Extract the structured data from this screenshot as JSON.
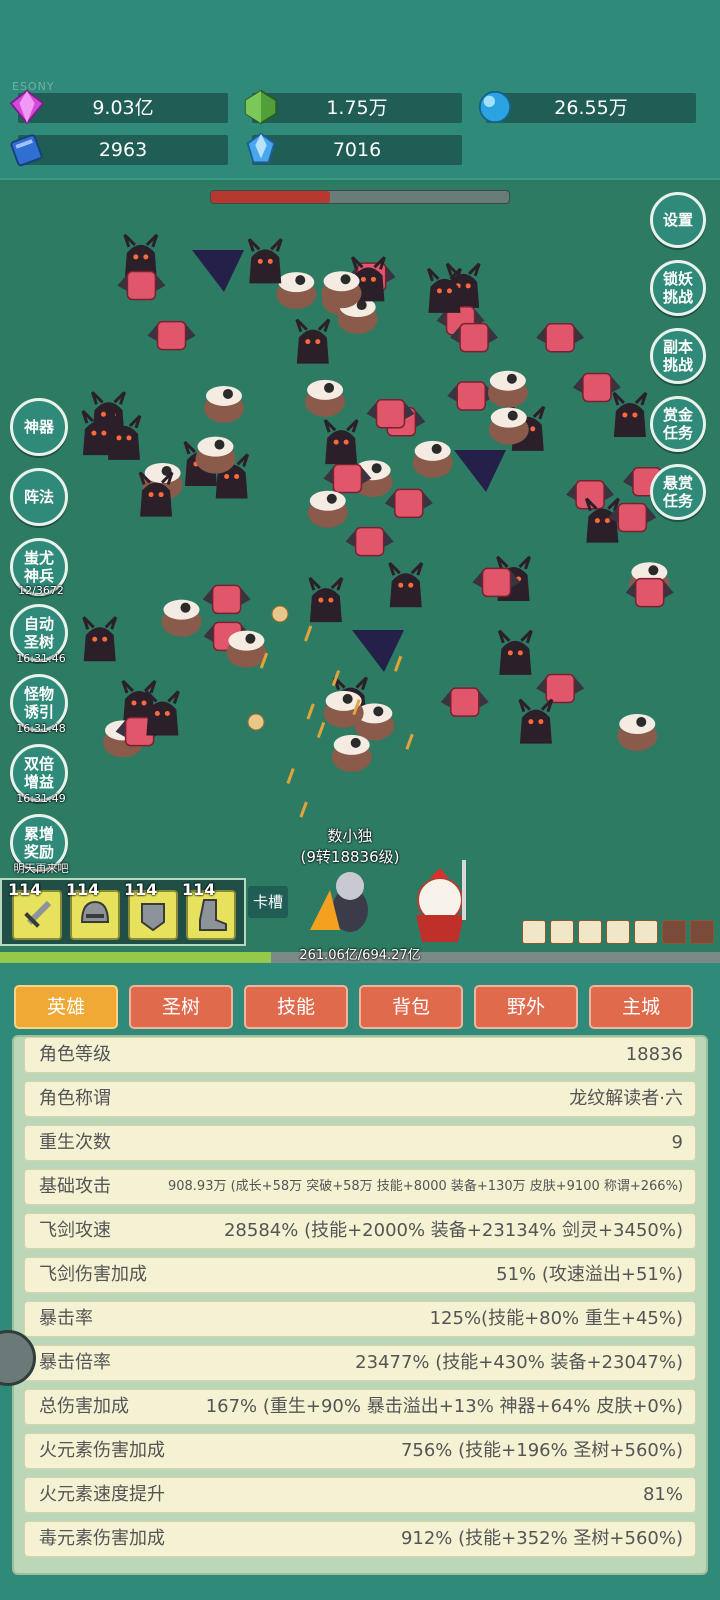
{
  "watermark": "ESONY",
  "currencies": [
    {
      "icon": "purple-gem-icon",
      "value": "9.03亿"
    },
    {
      "icon": "green-crystal-icon",
      "value": "1.75万"
    },
    {
      "icon": "blue-orb-icon",
      "value": "26.55万"
    },
    {
      "icon": "blue-book-icon",
      "value": "2963"
    },
    {
      "icon": "blue-shard-icon",
      "value": "7016"
    }
  ],
  "boss_hp_fraction": 0.4,
  "right_menu": [
    {
      "label": "设置"
    },
    {
      "label": "锁妖\n挑战"
    },
    {
      "label": "副本\n挑战"
    },
    {
      "label": "赏金\n任务"
    },
    {
      "label": "悬赏\n任务"
    }
  ],
  "left_menu": [
    {
      "label": "神器",
      "timer": ""
    },
    {
      "label": "阵法",
      "timer": ""
    },
    {
      "label": "蚩尤\n神兵",
      "timer": "12/3672"
    },
    {
      "label": "自动\n圣树",
      "timer": "16:31:46"
    },
    {
      "label": "怪物\n诱引",
      "timer": "16:31:48"
    },
    {
      "label": "双倍\n增益",
      "timer": "16:31:49"
    },
    {
      "label": "累增\n奖励",
      "timer": "明天再来吧"
    }
  ],
  "hero": {
    "name": "数小独",
    "level": "(9转18836级)"
  },
  "equipment_slots": [
    {
      "level": "114",
      "icon": "sword-icon"
    },
    {
      "level": "114",
      "icon": "helmet-icon"
    },
    {
      "level": "114",
      "icon": "armor-icon"
    },
    {
      "level": "114",
      "icon": "boots-icon"
    }
  ],
  "card_slot_label": "卡槽",
  "experience": {
    "text": "261.06亿/694.27亿",
    "fraction": 0.376
  },
  "tabs": [
    "英雄",
    "圣树",
    "技能",
    "背包",
    "野外",
    "主城"
  ],
  "active_tab": "英雄",
  "stats": [
    {
      "key": "角色等级",
      "value": "18836"
    },
    {
      "key": "角色称谓",
      "value": "龙纹解读者·六"
    },
    {
      "key": "重生次数",
      "value": "9"
    },
    {
      "key": "基础攻击",
      "value": "908.93万 (成长+58万 突破+58万 技能+8000 装备+130万 皮肤+9100 称谓+266%)"
    },
    {
      "key": "飞剑攻速",
      "value": "28584% (技能+2000% 装备+23134% 剑灵+3450%)"
    },
    {
      "key": "飞剑伤害加成",
      "value": "51% (攻速溢出+51%)"
    },
    {
      "key": "暴击率",
      "value": "125%(技能+80% 重生+45%)"
    },
    {
      "key": "暴击倍率",
      "value": "23477% (技能+430% 装备+23047%)"
    },
    {
      "key": "总伤害加成",
      "value": "167% (重生+90% 暴击溢出+13% 神器+64% 皮肤+0%)"
    },
    {
      "key": "火元素伤害加成",
      "value": "756% (技能+196% 圣树+560%)"
    },
    {
      "key": "火元素速度提升",
      "value": "81%"
    },
    {
      "key": "毒元素伤害加成",
      "value": "912% (技能+352% 圣树+560%)"
    }
  ]
}
